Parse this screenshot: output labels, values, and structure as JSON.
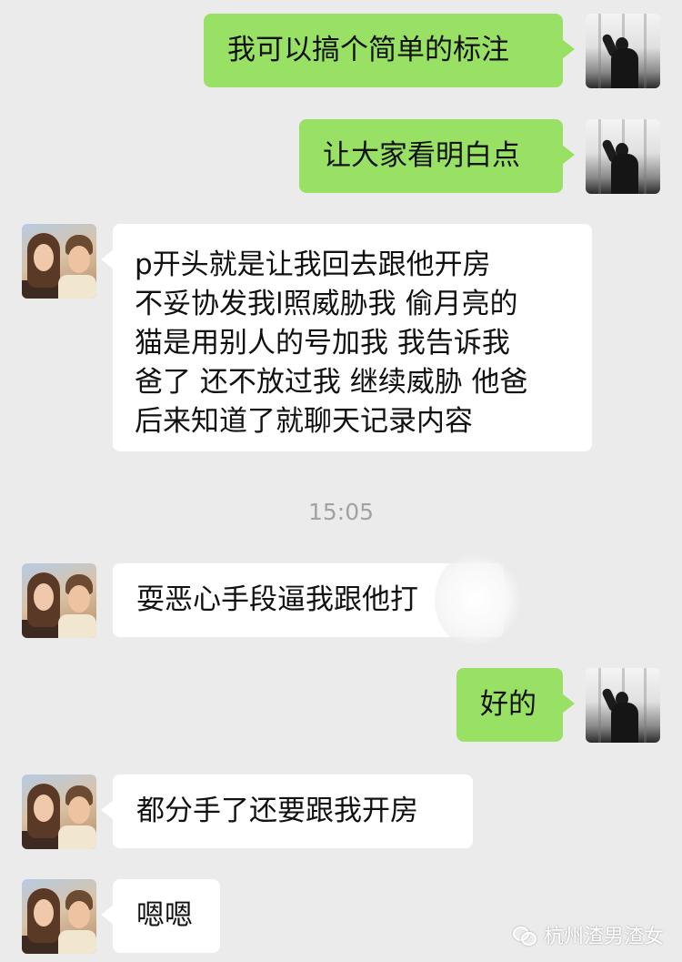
{
  "messages": [
    {
      "side": "self",
      "text": "我可以搞个简单的标注"
    },
    {
      "side": "self",
      "text": "让大家看明白点"
    },
    {
      "side": "other",
      "text": "p开头就是让我回去跟他开房\n不妥协发我l照威胁我 偷月亮的\n猫是用别人的号加我 我告诉我\n爸了 还不放过我 继续威胁 他爸\n后来知道了就聊天记录内容"
    },
    {
      "side": "other",
      "text": "耍恶心手段逼我跟他打"
    },
    {
      "side": "self",
      "text": "好的"
    },
    {
      "side": "other",
      "text": "都分手了还要跟我开房"
    },
    {
      "side": "other",
      "text": "嗯嗯"
    }
  ],
  "timestamp": "15:05",
  "watermark": {
    "icon": "wechat-icon",
    "text": "杭州渣男渣女"
  },
  "colors": {
    "self_bubble": "#98e165",
    "other_bubble": "#ffffff",
    "background": "#ebebeb"
  }
}
